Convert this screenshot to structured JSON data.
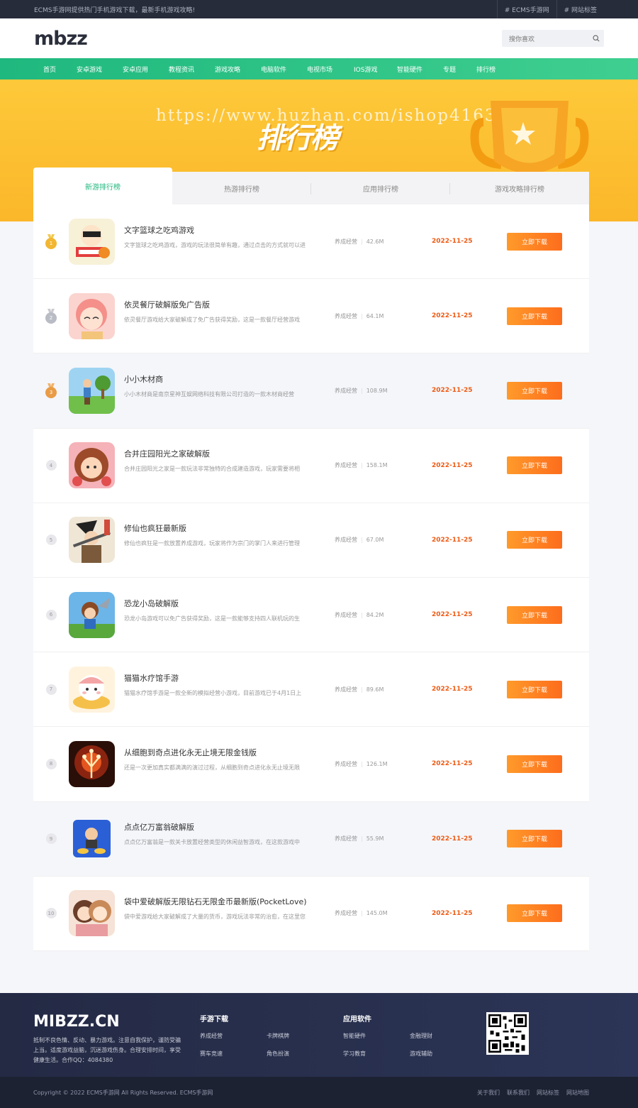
{
  "topbar": {
    "notice": "ECMS手游网提供热门手机游戏下载，最新手机游戏攻略!",
    "tags": [
      "# ECMS手游网",
      "# 网站标签"
    ]
  },
  "header": {
    "logo": "mbzz",
    "search_placeholder": "搜你喜欢"
  },
  "nav": [
    "首页",
    "安卓游戏",
    "安卓应用",
    "教程资讯",
    "游戏攻略",
    "电脑软件",
    "电视市场",
    "IOS游戏",
    "智能硬件",
    "专题",
    "排行榜"
  ],
  "banner": {
    "title": "排行榜",
    "watermark": "https://www.huzhan.com/ishop41633"
  },
  "tabs": [
    "新游排行榜",
    "热游排行榜",
    "应用排行榜",
    "游戏攻略排行榜"
  ],
  "list": [
    {
      "rank": "1",
      "name": "文字篮球之吃鸡游戏",
      "desc": "文字篮球之吃鸡游戏，游戏的玩法很简单有趣，通过点击的方式就可以进",
      "category": "养成经营",
      "size": "42.6M",
      "date": "2022-11-25",
      "button": "立即下载"
    },
    {
      "rank": "2",
      "name": "依灵餐厅破解版免广告版",
      "desc": "依灵餐厅游戏给大家破解成了免广告获得奖励，这是一款餐厅经营游戏",
      "category": "养成经营",
      "size": "64.1M",
      "date": "2022-11-25",
      "button": "立即下载"
    },
    {
      "rank": "3",
      "name": "小小木材商",
      "desc": "小小木材商是南京星神互娱网络科技有限公司打造的一款木材商经营",
      "category": "养成经营",
      "size": "108.9M",
      "date": "2022-11-25",
      "button": "立即下载"
    },
    {
      "rank": "4",
      "name": "合并庄园阳光之家破解版",
      "desc": "合并庄园阳光之家是一款玩法非常独特的合成建造游戏，玩家需要将相",
      "category": "养成经营",
      "size": "158.1M",
      "date": "2022-11-25",
      "button": "立即下载"
    },
    {
      "rank": "5",
      "name": "修仙也疯狂最新版",
      "desc": "修仙也疯狂是一款放置养成游戏，玩家将作为宗门的掌门人来进行管理",
      "category": "养成经营",
      "size": "67.0M",
      "date": "2022-11-25",
      "button": "立即下载"
    },
    {
      "rank": "6",
      "name": "恐龙小岛破解版",
      "desc": "恐龙小岛游戏可以免广告获得奖励，这是一款能够支持四人联机玩的生",
      "category": "养成经营",
      "size": "84.2M",
      "date": "2022-11-25",
      "button": "立即下载"
    },
    {
      "rank": "7",
      "name": "猫猫水疗馆手游",
      "desc": "猫猫水疗馆手游是一款全新的模拟经营小游戏，目前游戏已于4月1日上",
      "category": "养成经营",
      "size": "89.6M",
      "date": "2022-11-25",
      "button": "立即下载"
    },
    {
      "rank": "8",
      "name": "从细胞到奇点进化永无止境无限金钱版",
      "desc": "还是一次更加真实都满满的演过过程，从细胞到奇点进化永无止境无限",
      "category": "养成经营",
      "size": "126.1M",
      "date": "2022-11-25",
      "button": "立即下载"
    },
    {
      "rank": "9",
      "name": "点点亿万富翁破解版",
      "desc": "点点亿万富翁是一款关卡放置经营类型的休闲益智游戏，在这款游戏中",
      "category": "养成经营",
      "size": "55.9M",
      "date": "2022-11-25",
      "button": "立即下载"
    },
    {
      "rank": "10",
      "name": "袋中爱破解版无限钻石无限金币最新版(PocketLove)",
      "desc": "袋中爱游戏给大家破解成了大量的货币，游戏玩法非常的治愈，在这里您",
      "category": "养成经营",
      "size": "145.0M",
      "date": "2022-11-25",
      "button": "立即下载"
    }
  ],
  "footer": {
    "logo": "MIBZZ.CN",
    "text": "抵制不良色情、反动、暴力游戏。注意自我保护，谨防受骗上当。适度游戏益脑，沉迷游戏伤身。合理安排时间，享受健康生活。合作QQ：4084380",
    "col1": {
      "title": "手游下载",
      "links": [
        "养成经营",
        "卡牌棋牌",
        "赛车竞速",
        "角色扮演"
      ]
    },
    "col2": {
      "title": "应用软件",
      "links": [
        "智能硬件",
        "金融理财",
        "学习教育",
        "游戏辅助"
      ]
    },
    "copyright": "Copyright © 2022 ECMS手游网 All Rights Reserved. ECMS手游网",
    "links": [
      "关于我们",
      "联系我们",
      "网站标签",
      "网站地图"
    ]
  },
  "colors": {
    "accent": "#1fb87e",
    "banner": "#fdc93a",
    "date": "#f05a12",
    "button": "#fd7e22",
    "footer": "#242a44"
  }
}
